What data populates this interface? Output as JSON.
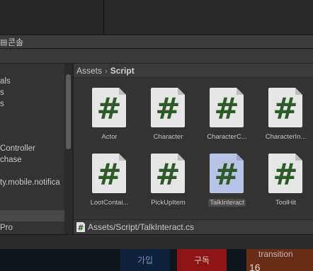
{
  "console": {
    "tab_label": "콘솔"
  },
  "left_tree": {
    "items": [
      "als",
      "s",
      "s",
      "Controller",
      "chase",
      "ty.mobile.notifica",
      "Pro"
    ]
  },
  "breadcrumb": {
    "root": "Assets",
    "current": "Script"
  },
  "assets": [
    {
      "name": "Actor",
      "selected": false
    },
    {
      "name": "Character",
      "selected": false
    },
    {
      "name": "CharacterC...",
      "selected": false
    },
    {
      "name": "CharacterIn...",
      "selected": false
    },
    {
      "name": "LootContai...",
      "selected": false
    },
    {
      "name": "PickUpItem",
      "selected": false
    },
    {
      "name": "TalkInteract",
      "selected": true
    },
    {
      "name": "ToolHit",
      "selected": false
    }
  ],
  "path_bar": {
    "path": "Assets/Script/TalkInteract.cs"
  },
  "icon_glyph": "#",
  "footer": {
    "join_label": "가입",
    "subscribe_label": "구독",
    "overlay_title": "transition",
    "overlay_value": "16"
  },
  "colors": {
    "script_icon_bg": "#e6e6e6",
    "script_icon_bg_selected": "#b9c3e6",
    "script_hash": "#2e5a2a",
    "subscribe_bg": "#8b1414",
    "join_bg": "#10213a"
  }
}
